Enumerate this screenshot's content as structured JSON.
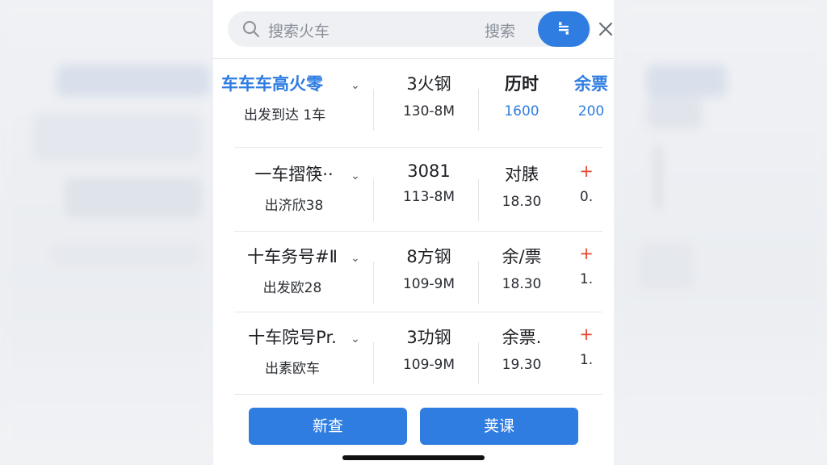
{
  "search": {
    "placeholder": "搜索火车",
    "search_label": "搜索",
    "filter_label": "≒"
  },
  "rows": [
    {
      "name": "车车车高火零",
      "sub": "出发到达 1车",
      "col2_top": "3火钢",
      "col2_bottom": "130-8M",
      "col3_top": "历时",
      "col3_bottom": "1600",
      "col4_top": "余票",
      "col4_bottom": "200"
    },
    {
      "name": "一车摺筷··",
      "sub": "出济欣38",
      "col2_top": "3081",
      "col2_bottom": "113-8M",
      "col3_top": "对脿",
      "col3_bottom": "18.30",
      "col4_top": "+",
      "col4_bottom": "0."
    },
    {
      "name": "十车务号#Ⅱ",
      "sub": "出发欧28",
      "col2_top": "8方钢",
      "col2_bottom": "109-9M",
      "col3_top": "余/票",
      "col3_bottom": "18.30",
      "col4_top": "+",
      "col4_bottom": "1."
    },
    {
      "name": "十车院号Pr.",
      "sub": "出素欧车",
      "col2_top": "3功钢",
      "col2_bottom": "109-9M",
      "col3_top": "余票.",
      "col3_bottom": "19.30",
      "col4_top": "+",
      "col4_bottom": "1."
    }
  ],
  "buttons": {
    "left": "新查",
    "right": "荚课"
  },
  "colors": {
    "accent": "#2f7de1",
    "plus": "#e3452f"
  }
}
